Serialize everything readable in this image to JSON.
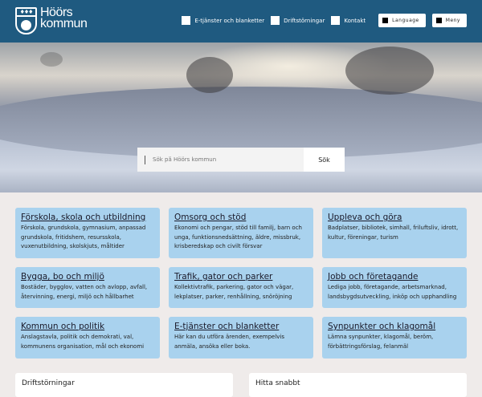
{
  "header": {
    "logo_line1": "Höörs",
    "logo_line2": "kommun",
    "nav": [
      {
        "label": "E-tjänster och blanketter"
      },
      {
        "label": "Driftstörningar"
      },
      {
        "label": "Kontakt"
      }
    ],
    "language_label": "Language",
    "menu_label": "Meny"
  },
  "search": {
    "placeholder": "Sök på Höörs kommun",
    "button_label": "Sök"
  },
  "cards": [
    {
      "title": "Förskola, skola och utbildning",
      "text": "Förskola, grundskola, gymnasium, anpassad grundskola, fritidshem, resursskola, vuxenutbildning, skolskjuts, måltider"
    },
    {
      "title": "Omsorg och stöd",
      "text": "Ekonomi och pengar, stöd till familj, barn och unga, funktionsnedsättning, äldre, missbruk, krisberedskap och civilt försvar"
    },
    {
      "title": "Uppleva och göra",
      "text": "Badplatser, bibliotek, simhall, friluftsliv, idrott, kultur, föreningar, turism"
    },
    {
      "title": "Bygga, bo och miljö",
      "text": "Bostäder, bygglov, vatten och avlopp, avfall, återvinning, energi, miljö och hållbarhet"
    },
    {
      "title": "Trafik, gator och parker",
      "text": "Kollektivtrafik, parkering, gator och vägar, lekplatser, parker, renhållning, snöröjning"
    },
    {
      "title": "Jobb och företagande",
      "text": "Lediga jobb, företagande, arbetsmarknad, landsbygdsutveckling, inköp och upphandling"
    },
    {
      "title": "Kommun och politik",
      "text": "Anslagstavla, politik och demokrati, val, kommunens organisation, mål och ekonomi"
    },
    {
      "title": "E-tjänster och blanketter",
      "text": "Här kan du utföra ärenden, exempelvis anmäla, ansöka eller boka."
    },
    {
      "title": "Synpunkter och klagomål",
      "text": "Lämna synpunkter, klagomål, beröm, förbättringsförslag, felanmäl"
    }
  ],
  "panels": {
    "left_title": "Driftstörningar",
    "right_title": "Hitta snabbt"
  }
}
